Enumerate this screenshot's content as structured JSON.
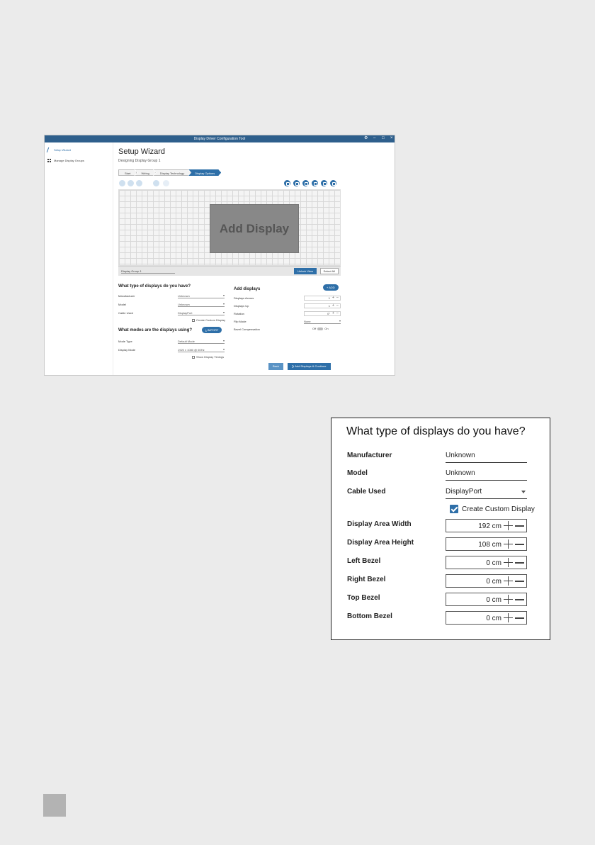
{
  "window": {
    "title": "Display Driver Configuration Tool",
    "controls": [
      "⚙",
      "–",
      "□",
      "×"
    ]
  },
  "sidebar": {
    "items": [
      {
        "label": "Setup Wizard",
        "icon": "wand-icon",
        "active": true
      },
      {
        "label": "Manage Display Groups",
        "icon": "grid-icon",
        "active": false
      }
    ]
  },
  "wizard": {
    "title": "Setup Wizard",
    "subtitle": "Designing Display Group 1",
    "steps": [
      "Start",
      "Wiring",
      "Display Technology",
      "Display Options"
    ],
    "active_step": 3
  },
  "canvas": {
    "add_display": "Add Display",
    "group_name": "Display Group 1",
    "unlock_view": "Unlock View",
    "select_all": "Select All"
  },
  "types_section": {
    "title": "What type of displays do you have?",
    "manufacturer_label": "Manufacturer",
    "manufacturer_value": "Unknown",
    "model_label": "Model",
    "model_value": "Unknown",
    "cable_label": "Cable Used",
    "cable_value": "DisplayPort",
    "custom_label": "Create Custom Display"
  },
  "modes_section": {
    "title": "What modes are the displays using?",
    "import_label": "IMPORT",
    "mode_type_label": "Mode Type",
    "mode_type_value": "Default Mode",
    "display_mode_label": "Display Mode",
    "display_mode_value": "1920 x 1080 @ 60Hz",
    "timings_label": "Show Display Timings"
  },
  "add_section": {
    "title": "Add displays",
    "add_label": "ADD",
    "across_label": "Displays Across",
    "across_value": "1",
    "up_label": "Displays Up",
    "up_value": "1",
    "rotation_label": "Rotation",
    "rotation_value": "0°",
    "flip_label": "Flip Mode",
    "flip_value": "None",
    "bezel_label": "Bezel Compensation",
    "off": "Off",
    "on": "On"
  },
  "footer_buttons": {
    "back": "Back",
    "continue": "Add Displays & Continue"
  },
  "zoom_panel": {
    "title": "What type of displays do you have?",
    "manufacturer_label": "Manufacturer",
    "manufacturer_value": "Unknown",
    "model_label": "Model",
    "model_value": "Unknown",
    "cable_label": "Cable Used",
    "cable_value": "DisplayPort",
    "custom_label": "Create Custom Display",
    "fields": [
      {
        "label": "Display Area Width",
        "value": "192 cm"
      },
      {
        "label": "Display Area Height",
        "value": "108 cm"
      },
      {
        "label": "Left Bezel",
        "value": "0 cm"
      },
      {
        "label": "Right Bezel",
        "value": "0 cm"
      },
      {
        "label": "Top Bezel",
        "value": "0 cm"
      },
      {
        "label": "Bottom Bezel",
        "value": "0 cm"
      }
    ]
  },
  "colors": {
    "accent": "#2e6fa8",
    "titlebar": "#2e5f8c",
    "page_bg": "#ebebeb"
  }
}
